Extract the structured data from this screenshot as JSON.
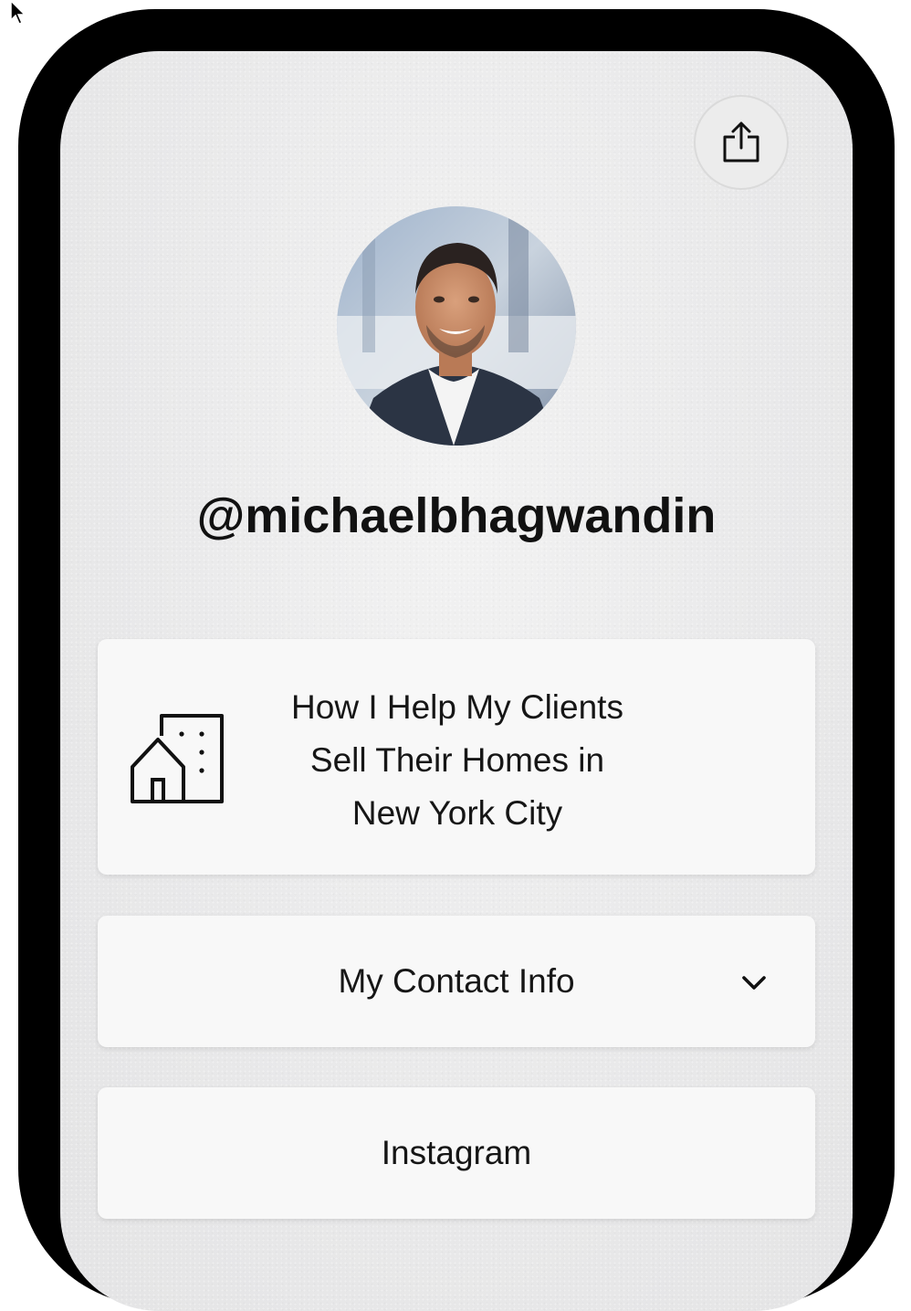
{
  "profile": {
    "username": "@michaelbhagwandin",
    "avatar_alt": "michaelbhagwandin"
  },
  "header": {
    "share_icon": "share-icon"
  },
  "links": [
    {
      "label": "How I Help My Clients Sell Their Homes in New York City",
      "lines": [
        "How I Help My Clients",
        "Sell Their Homes in",
        "New York City"
      ],
      "icon": "building-icon"
    },
    {
      "label": "My Contact Info",
      "icon": "chevron-down-icon"
    },
    {
      "label": "Instagram"
    }
  ],
  "colors": {
    "frame": "#000000",
    "background": "#e9e9ea",
    "card": "#f8f8f8",
    "text": "#111111"
  }
}
